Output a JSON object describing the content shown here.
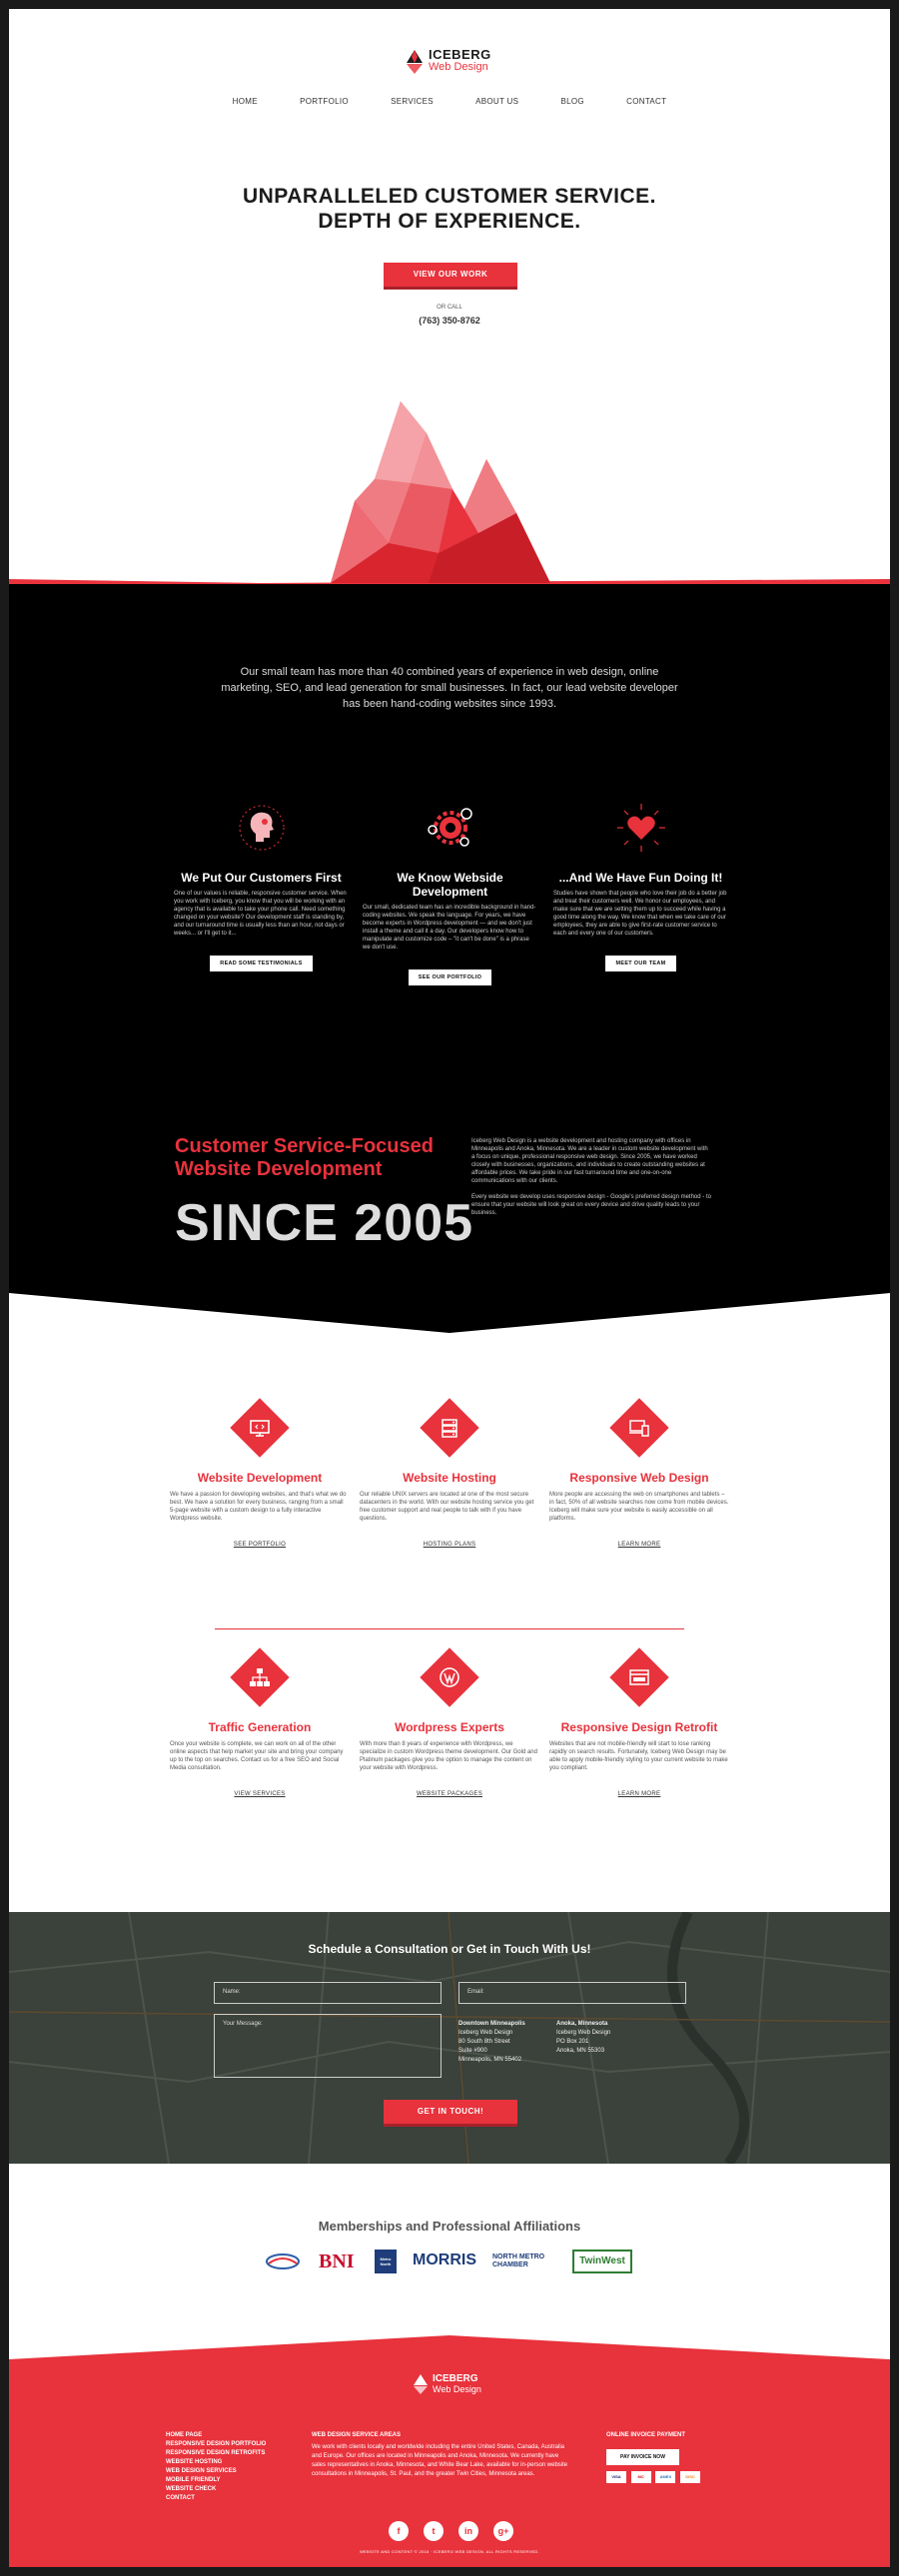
{
  "brand": {
    "name": "ICEBERG",
    "sub": "Web Design",
    "red": "#e8323c",
    "dark": "#000000"
  },
  "nav": [
    "HOME",
    "PORTFOLIO",
    "SERVICES",
    "ABOUT US",
    "BLOG",
    "CONTACT"
  ],
  "hero": {
    "title_line1": "UNPARALLELED CUSTOMER SERVICE.",
    "title_line2": "DEPTH OF EXPERIENCE.",
    "button": "VIEW OUR WORK",
    "or_call": "OR CALL",
    "phone": "(763) 350-8762"
  },
  "intro": "Our small team has more than 40 combined years of experience in web design, online marketing, SEO, and lead generation for small businesses. In fact, our lead website developer has been hand-coding websites since 1993.",
  "features": [
    {
      "icon": "customer-head-icon",
      "title": "We Put Our Customers First",
      "text": "One of our values is reliable, responsive customer service. When you work with Iceberg, you know that you will be working with an agency that is available to take your phone call. Need something changed on your website? Our development staff is standing by, and our turnaround time is usually less than an hour, not days or weeks... or I'll get to it...",
      "button": "READ SOME TESTIMONIALS"
    },
    {
      "icon": "gears-icon",
      "title": "We Know Webside Development",
      "text": "Our small, dedicated team has an incredible background in hand-coding websites. We speak the language. For years, we have become experts in Wordpress development — and we don't just install a theme and call it a day. Our developers know how to manipulate and customize code – \"it can't be done\" is a phrase we don't use.",
      "button": "SEE OUR PORTFOLIO"
    },
    {
      "icon": "heart-icon",
      "title": "...And We Have Fun Doing It!",
      "text": "Studies have shown that people who love their job do a better job and treat their customers well. We honor our employees, and make sure that we are setting them up to succeed while having a good time along the way. We know that when we take care of our employees, they are able to give first-rate customer service to each and every one of our customers.",
      "button": "MEET OUR TEAM"
    }
  ],
  "since": {
    "line1": "Customer Service-Focused",
    "line2": "Website Development",
    "big": "SINCE 2005",
    "para1": "Iceberg Web Design is a website development and hosting company with offices in Minneapolis and Anoka, Minnesota. We are a leader in custom website development with a focus on unique, professional responsive web design. Since 2005, we have worked closely with businesses, organizations, and individuals to create outstanding websites at affordable prices. We take pride in our fast turnaround time and one-on-one communications with our clients.",
    "para2": "Every website we develop uses responsive design - Google's preferred design method - to ensure that your website will look great on every device and drive quality leads to your business."
  },
  "services": [
    {
      "icon": "monitor-code-icon",
      "title": "Website Development",
      "text": "We have a passion for developing websites, and that's what we do best. We have a solution for every business, ranging from a small 5-page website with a custom design to a fully interactive Wordpress website.",
      "link": "SEE PORTFOLIO"
    },
    {
      "icon": "server-icon",
      "title": "Website Hosting",
      "text": "Our reliable UNIX servers are located at one of the most secure datacenters in the world. With our website hosting service you get free customer support and real people to talk with if you have questions.",
      "link": "HOSTING PLANS"
    },
    {
      "icon": "devices-icon",
      "title": "Responsive Web Design",
      "text": "More people are accessing the web on smartphones and tablets – in fact, 50% of all website searches now come from mobile devices. Iceberg will make sure your website is easily accessible on all platforms.",
      "link": "LEARN MORE"
    },
    {
      "icon": "network-icon",
      "title": "Traffic Generation",
      "text": "Once your website is complete, we can work on all of the other online aspects that help market your site and bring your company up to the top on searches. Contact us for a free SEO and Social Media consultation.",
      "link": "VIEW SERVICES"
    },
    {
      "icon": "wordpress-icon",
      "title": "Wordpress Experts",
      "text": "With more than 8 years of experience with Wordpress, we specialize in custom Wordpress theme development. Our Gold and Platinum packages give you the option to manage the content on your website with Wordpress.",
      "link": "WEBSITE PACKAGES"
    },
    {
      "icon": "browser-icon",
      "title": "Responsive Design Retrofit",
      "text": "Websites that are not mobile-friendly will start to lose ranking rapidly on search results. Fortunately, Iceberg Web Design may be able to apply mobile-friendly styling to your current website to make you compliant.",
      "link": "LEARN MORE"
    }
  ],
  "contact": {
    "title": "Schedule a Consultation or Get in Touch With Us!",
    "name_placeholder": "Name:",
    "email_placeholder": "Email:",
    "message_placeholder": "Your Message:",
    "office1": [
      "Downtown Minneapolis",
      "Iceberg Web Design",
      "80 South 8th Street",
      "Suite #900",
      "Minneapolis, MN 55402"
    ],
    "office2": [
      "Anoka, Minnesota",
      "Iceberg Web Design",
      "PO Box 201",
      "Anoka, MN 55303"
    ],
    "button": "GET IN TOUCH!"
  },
  "memberships": {
    "title": "Memberships and Professional Affiliations",
    "logos": [
      "anoka-chamber-logo",
      "BNI",
      "Metro North",
      "MORRIS",
      "NORTH METRO CHAMBER",
      "TwinWest"
    ]
  },
  "footer": {
    "links": [
      "HOME PAGE",
      "RESPONSIVE DESIGN PORTFOLIO",
      "RESPONSIVE DESIGN RETROFITS",
      "WEBSITE HOSTING",
      "WEB DESIGN SERVICES",
      "MOBILE FRIENDLY",
      "WEBSITE CHECK",
      "CONTACT"
    ],
    "areas_title": "WEB DESIGN SERVICE AREAS",
    "areas_text": "We work with clients locally and worldwide including the entire United States, Canada, Australia and Europe. Our offices are located in Minneapolis and Anoka, Minnesota. We currently have sales representatives in Anoka, Minnesota, and White Bear Lake, available for in-person website consultations in Minneapolis, St. Paul, and the greater Twin Cities, Minnesota areas.",
    "invoice_title": "ONLINE INVOICE PAYMENT",
    "invoice_button": "PAY INVOICE NOW",
    "cards": [
      "VISA",
      "MC",
      "AMEX",
      "DISC"
    ],
    "social": [
      "f",
      "t",
      "in",
      "g+"
    ],
    "copyright": "WEBSITE AND CONTENT © 2016 · ICEBERG WEB DESIGN. ALL RIGHTS RESERVED."
  }
}
